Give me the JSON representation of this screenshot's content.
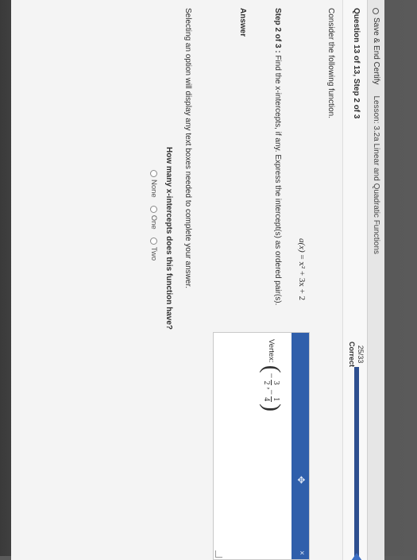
{
  "topbar": {
    "save_label": "Save & End Certify",
    "lesson": "Lesson: 3.2a Linear and Quadratic Functions"
  },
  "question_header": {
    "number": "Question 13 of 13, Step 2 of 3",
    "score": "25/33",
    "score_label": "Correct",
    "progress_fraction": 0.76
  },
  "problem": {
    "intro": "Consider the following function.",
    "function_lhs": "a(x)",
    "function_rhs": "= x² + 3x + 2",
    "step_label": "Step 2 of 3 :",
    "step_text": "Find the x-intercepts, if any. Express the intercept(s) as ordered pair(s).",
    "answer_label": "Answer",
    "selecting_note": "Selecting an option will display any text boxes needed to complete your answer.",
    "question": "How many x-intercepts does this function have?",
    "options": [
      "None",
      "One",
      "Two"
    ]
  },
  "vertex_panel": {
    "label": "Vertex:",
    "x_sign": "−",
    "x_num": "3",
    "x_den": "2",
    "y_sign": "−",
    "y_num": "1",
    "y_den": "4",
    "close_glyph": "×",
    "move_glyph": "✥"
  },
  "colors": {
    "accent": "#2f5fab",
    "progress": "#2e4f8f"
  }
}
